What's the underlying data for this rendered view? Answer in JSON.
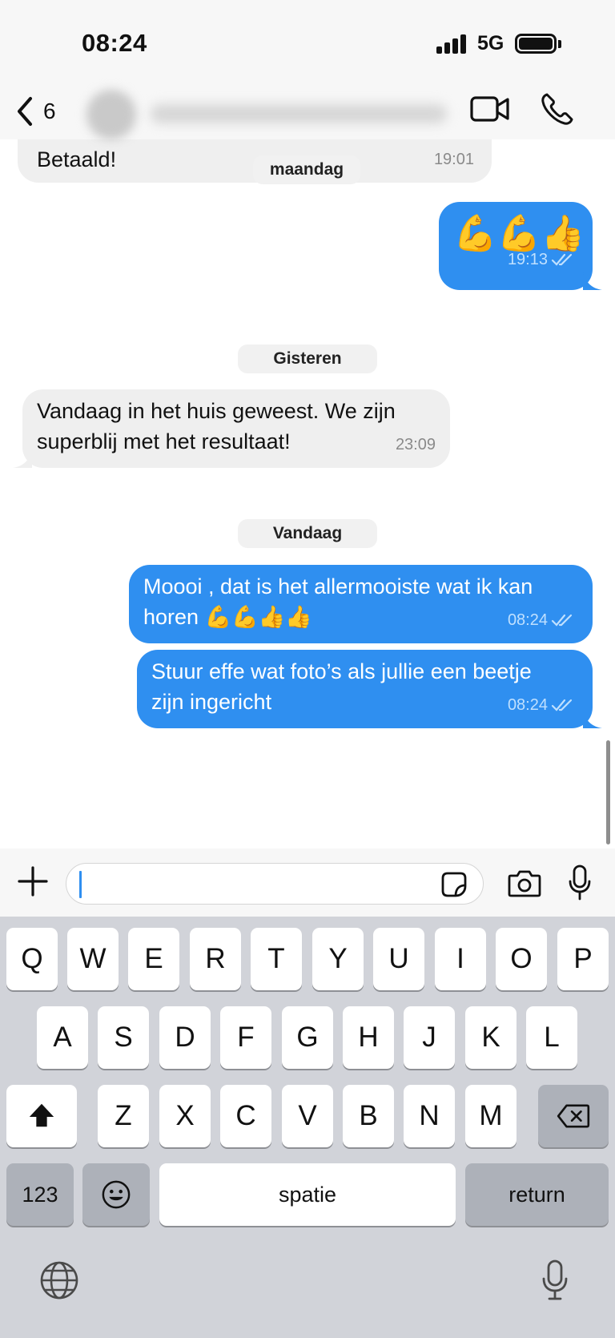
{
  "status_bar": {
    "time": "08:24",
    "network": "5G"
  },
  "header": {
    "back_count": "6",
    "icons": [
      "chevron-left-icon",
      "video-camera-icon",
      "phone-icon"
    ]
  },
  "messages": {
    "m1": {
      "direction": "incoming",
      "text": "Betaald!",
      "time": "19:01"
    },
    "m2": {
      "direction": "outgoing",
      "text": "💪💪👍",
      "time": "19:13",
      "status": "read"
    },
    "m3": {
      "direction": "incoming",
      "text": "Vandaag in het huis geweest. We zijn superblij met het resultaat!",
      "time": "23:09"
    },
    "m4": {
      "direction": "outgoing",
      "text": "Moooi , dat is het allermooiste wat ik kan horen 💪💪👍👍",
      "time": "08:24",
      "status": "read"
    },
    "m5": {
      "direction": "outgoing",
      "text": "Stuur effe wat foto’s als jullie een beetje zijn ingericht",
      "time": "08:24",
      "status": "read"
    }
  },
  "date_separators": {
    "monday": "maandag",
    "yesterday": "Gisteren",
    "today": "Vandaag"
  },
  "composer": {
    "input_value": "",
    "icons": [
      "plus-icon",
      "sticker-icon",
      "camera-icon",
      "microphone-icon"
    ]
  },
  "keyboard": {
    "row1": [
      "Q",
      "W",
      "E",
      "R",
      "T",
      "Y",
      "U",
      "I",
      "O",
      "P"
    ],
    "row2": [
      "A",
      "S",
      "D",
      "F",
      "G",
      "H",
      "J",
      "K",
      "L"
    ],
    "row3": [
      "Z",
      "X",
      "C",
      "V",
      "B",
      "N",
      "M"
    ],
    "numbers_key": "123",
    "space_key": "spatie",
    "return_key": "return",
    "icons": [
      "shift-icon",
      "backspace-icon",
      "emoji-icon",
      "globe-icon",
      "dictation-mic-icon"
    ]
  },
  "colors": {
    "outgoing_bubble": "#2f8ff0",
    "incoming_bubble": "#efefef",
    "keyboard_bg": "#d1d3d9"
  }
}
